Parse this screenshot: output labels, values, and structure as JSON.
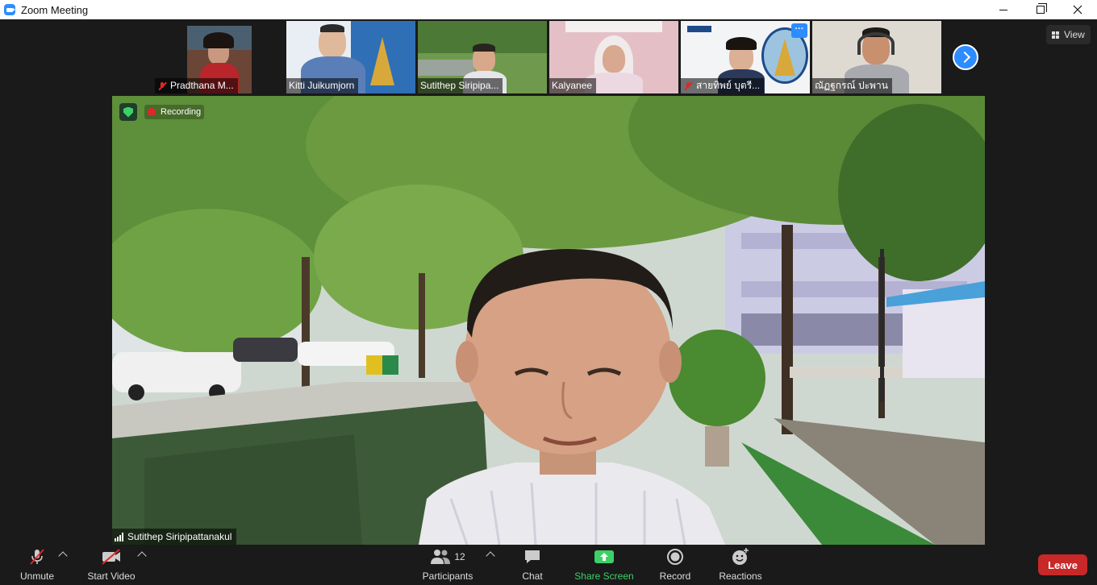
{
  "window": {
    "title": "Zoom Meeting"
  },
  "view_button": {
    "label": "View"
  },
  "participants_strip": [
    {
      "name": "Pradthana M...",
      "muted": true,
      "bg": "#7a4a3a"
    },
    {
      "name": "Kitti Juikumjorn",
      "muted": false,
      "bg": "#3a6fa8"
    },
    {
      "name": "Sutithep Siripipa...",
      "muted": false,
      "bg": "#5c8a44",
      "active": true
    },
    {
      "name": "Kalyanee",
      "muted": false,
      "bg": "#e8c4c8"
    },
    {
      "name": "สายทิพย์  บุตรี...",
      "muted": true,
      "bg": "#cfe0ee"
    },
    {
      "name": "ณัฏฐกรณ์ ปะพาน",
      "muted": false,
      "bg": "#d8d4cc"
    }
  ],
  "speaker": {
    "name": "Sutithep Siripipattanakul",
    "recording_label": "Recording"
  },
  "toolbar": {
    "unmute": "Unmute",
    "start_video": "Start Video",
    "participants": "Participants",
    "participants_count": "12",
    "chat": "Chat",
    "share_screen": "Share Screen",
    "record": "Record",
    "reactions": "Reactions",
    "leave": "Leave"
  },
  "colors": {
    "accent": "#2d8cff",
    "leave": "#c82828",
    "share": "#3cd167",
    "muted": "#e02828"
  }
}
